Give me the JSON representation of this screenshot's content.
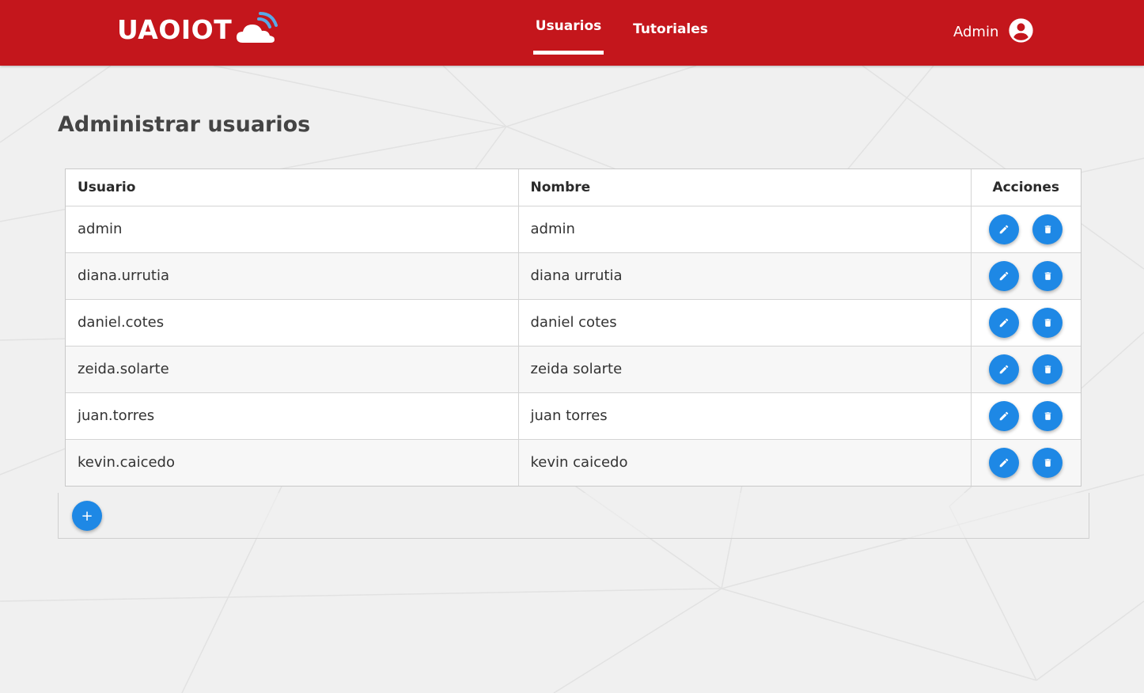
{
  "brand": {
    "logo_text": "UAOIOT",
    "logo_icon": "cloud-wifi-icon",
    "color": "#c4161c"
  },
  "nav": {
    "items": [
      {
        "label": "Usuarios",
        "active": true
      },
      {
        "label": "Tutoriales",
        "active": false
      }
    ]
  },
  "user": {
    "name": "Admin",
    "icon": "account-circle-icon"
  },
  "page": {
    "title": "Administrar usuarios"
  },
  "table": {
    "headers": {
      "user": "Usuario",
      "name": "Nombre",
      "actions": "Acciones"
    },
    "rows": [
      {
        "user": "admin",
        "name": "admin"
      },
      {
        "user": "diana.urrutia",
        "name": "diana urrutia"
      },
      {
        "user": "daniel.cotes",
        "name": "daniel cotes"
      },
      {
        "user": "zeida.solarte",
        "name": "zeida solarte"
      },
      {
        "user": "juan.torres",
        "name": "juan torres"
      },
      {
        "user": "kevin.caicedo",
        "name": "kevin caicedo"
      }
    ],
    "row_actions": [
      "edit-icon",
      "delete-icon"
    ]
  },
  "add_button": {
    "label": "+",
    "icon": "plus-icon"
  },
  "colors": {
    "accent": "#1e88e5",
    "background": "#f0f0f0"
  }
}
